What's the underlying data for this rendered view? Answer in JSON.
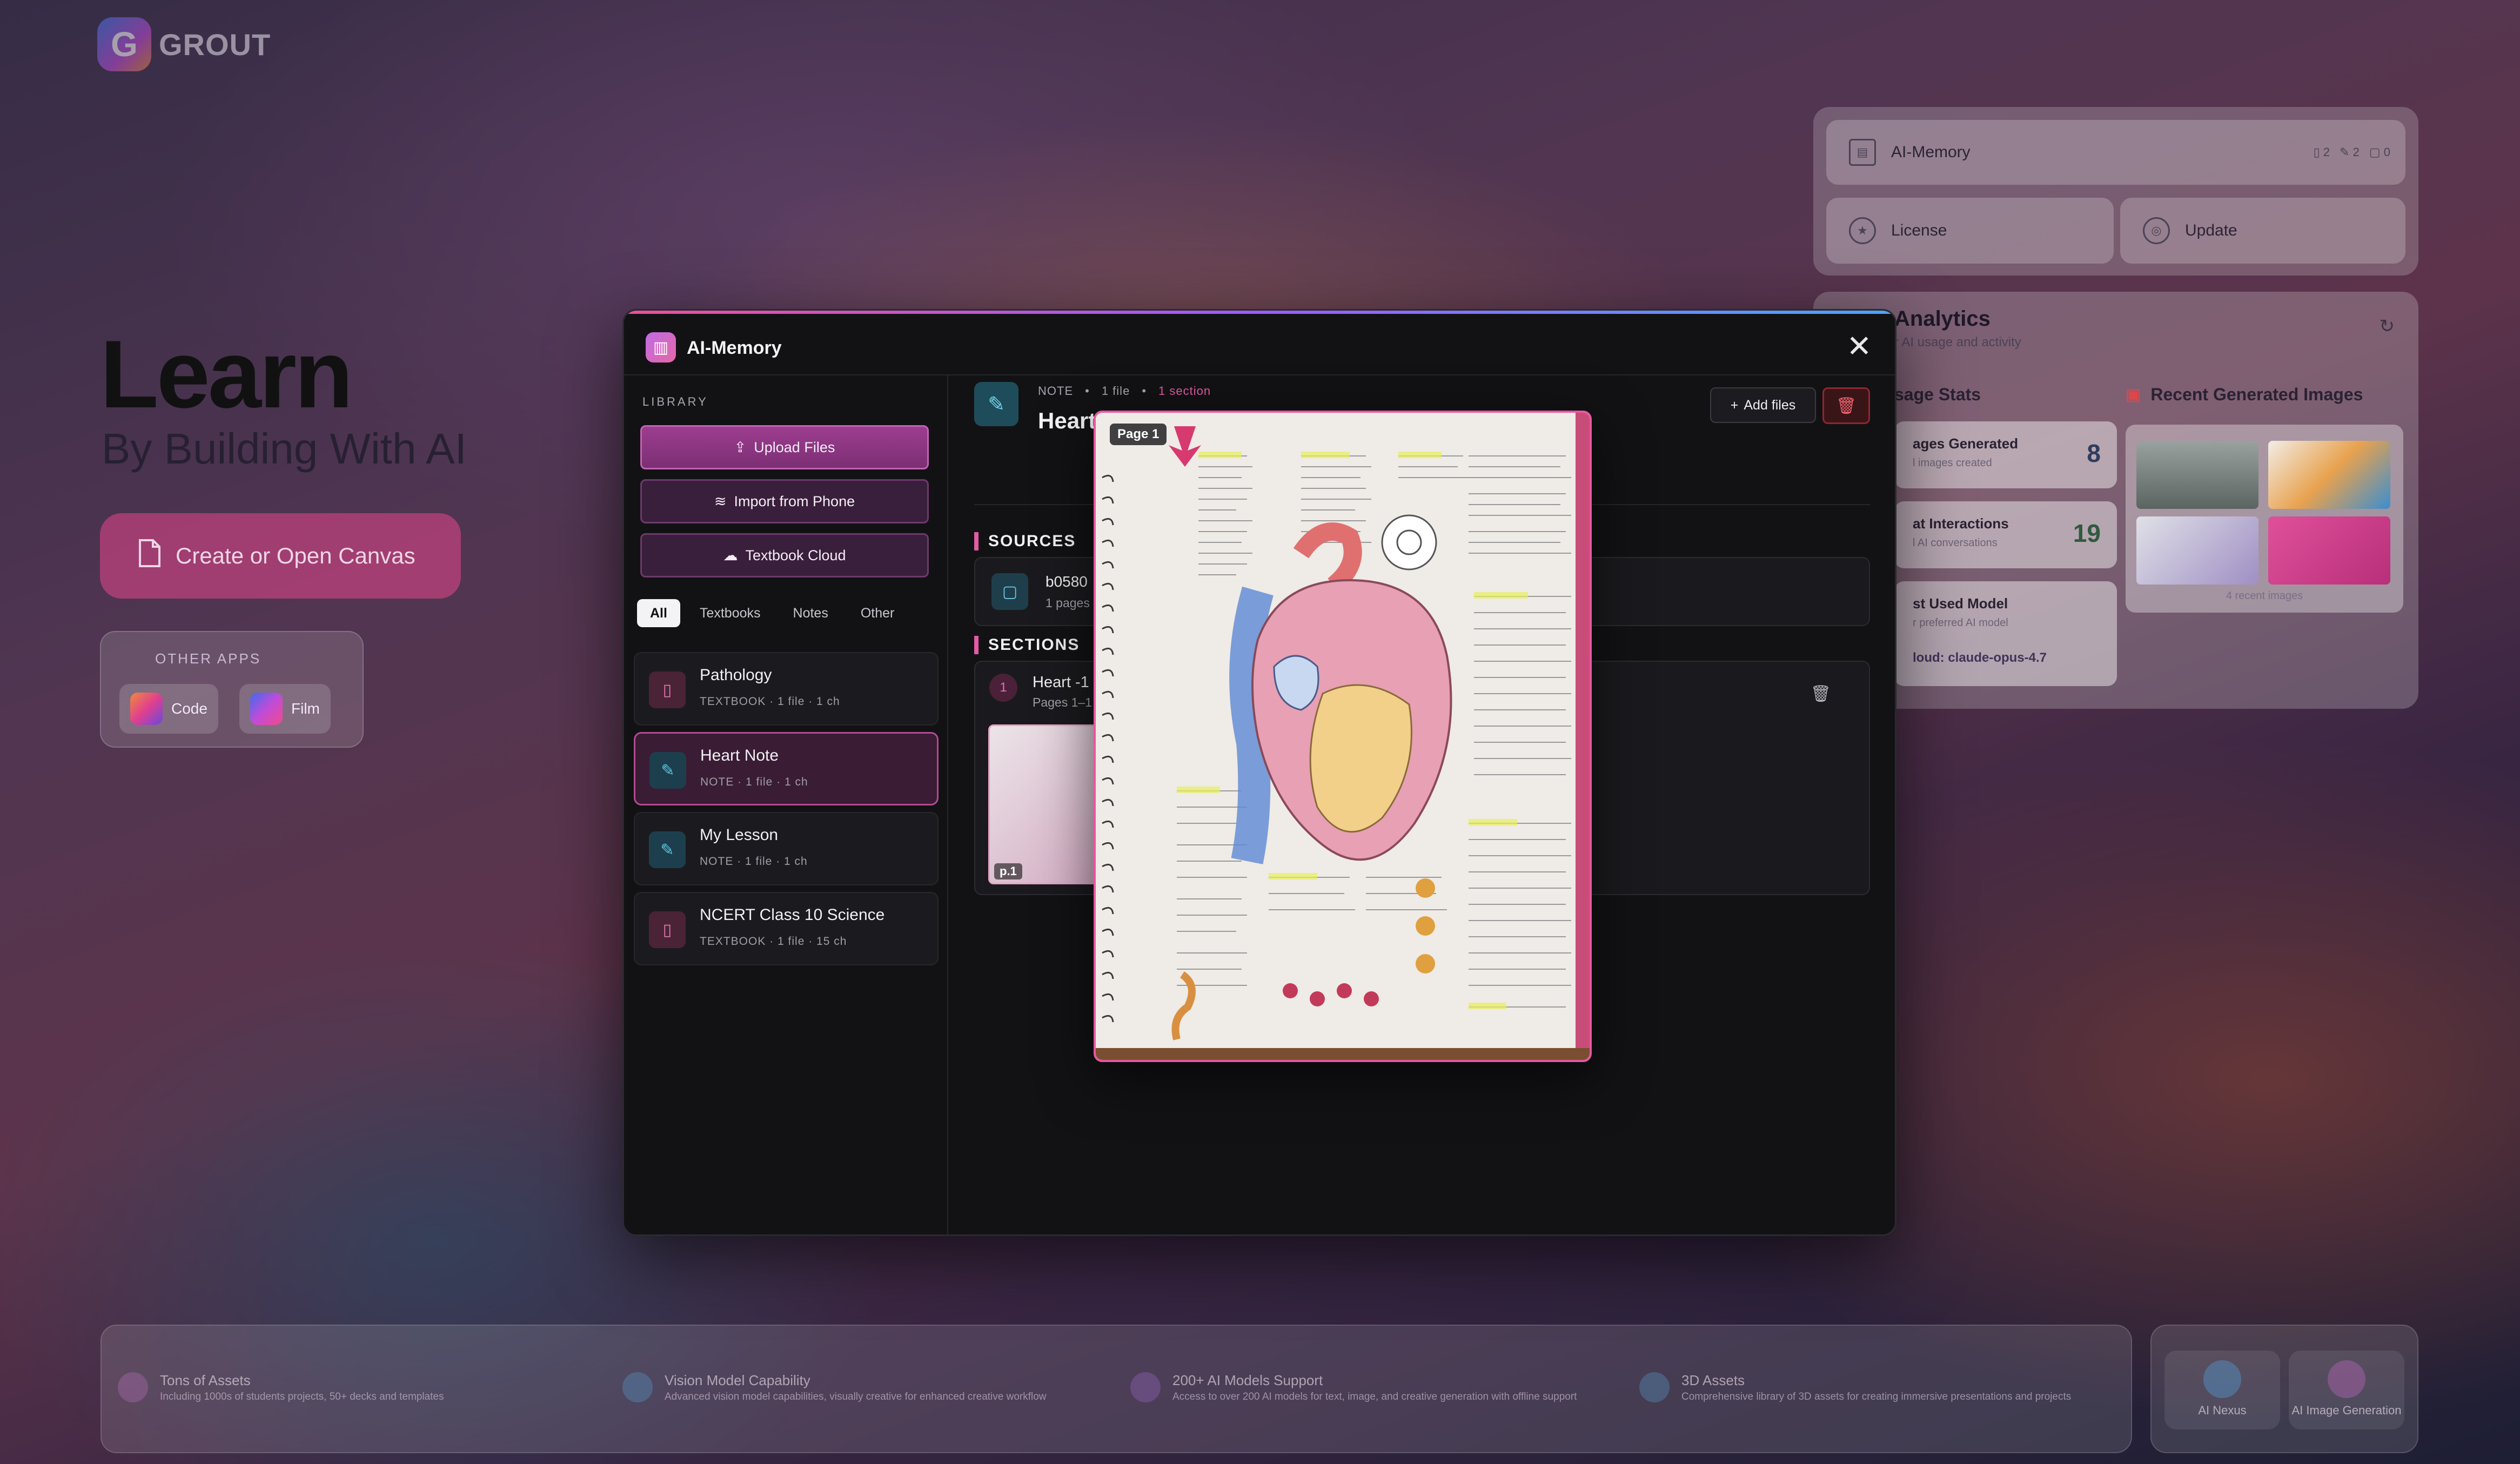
{
  "brand": {
    "name": "GROUT",
    "logo_letter": "G"
  },
  "hero": {
    "title": "Learn",
    "subtitle": "By Building With AI",
    "cta_label": "Create or Open Canvas"
  },
  "other_apps": {
    "title": "OTHER APPS",
    "apps": [
      {
        "label": "Code"
      },
      {
        "label": "Film"
      }
    ]
  },
  "right_panel": {
    "ai_memory_label": "AI-Memory",
    "counts": [
      "2",
      "2",
      "0"
    ],
    "license_label": "License",
    "update_label": "Update"
  },
  "analytics": {
    "title": "Analytics",
    "subtitle": "r AI usage and activity",
    "usage_heading": "sage Stats",
    "images_heading": "Recent Generated Images",
    "stats": [
      {
        "label": "ages Generated",
        "sub": "l images created",
        "value": "8"
      },
      {
        "label": "at Interactions",
        "sub": "l AI conversations",
        "value": "19"
      },
      {
        "label": "st Used Model",
        "sub": "r preferred AI model",
        "value": "loud: claude-opus-4.7"
      }
    ],
    "recent_images_note": "4 recent images"
  },
  "features": [
    {
      "title": "Tons of Assets",
      "desc": "Including 1000s of students projects, 50+ decks and templates"
    },
    {
      "title": "Vision Model Capability",
      "desc": "Advanced vision model capabilities, visually creative for enhanced creative workflow"
    },
    {
      "title": "200+ AI Models Support",
      "desc": "Access to over 200 AI models for text, image, and creative generation with offline support"
    },
    {
      "title": "3D Assets",
      "desc": "Comprehensive library of 3D assets for creating immersive presentations and projects"
    }
  ],
  "bottom_right": {
    "nexus_label": "AI Nexus",
    "image_gen_label": "AI Image Generation"
  },
  "modal": {
    "title": "AI-Memory",
    "close_symbol": "✕",
    "library_label": "LIBRARY",
    "buttons": {
      "upload": "Upload Files",
      "import": "Import from Phone",
      "cloud": "Textbook Cloud"
    },
    "filters": [
      "All",
      "Textbooks",
      "Notes",
      "Other"
    ],
    "items": [
      {
        "name": "Pathology",
        "meta": "TEXTBOOK  ·  1 file  ·  1 ch"
      },
      {
        "name": "Heart Note",
        "meta": "NOTE  ·  1 file  ·  1 ch"
      },
      {
        "name": "My Lesson",
        "meta": "NOTE  ·  1 file  ·  1 ch"
      },
      {
        "name": "NCERT Class 10 Science",
        "meta": "TEXTBOOK  ·  1 file  ·  15 ch"
      }
    ],
    "note": {
      "type": "NOTE",
      "files": "1 file",
      "sections": "1 section",
      "title": "Heart No",
      "add_files": "Add files"
    },
    "sources": {
      "heading": "SOURCES",
      "file_name": "b0580",
      "file_meta": "1 pages"
    },
    "sections": {
      "heading": "SECTIONS",
      "number": "1",
      "title": "Heart -1",
      "pages": "Pages 1–1",
      "thumb_label": "p.1"
    },
    "preview": {
      "page_label": "Page 1"
    }
  }
}
